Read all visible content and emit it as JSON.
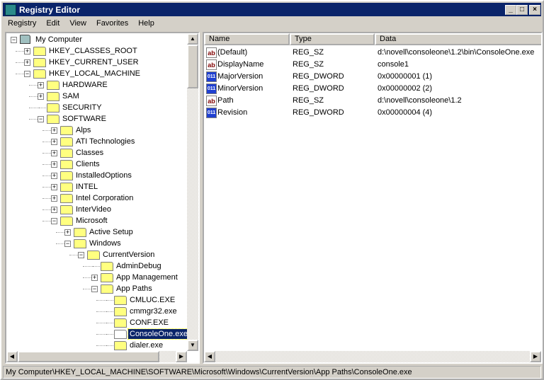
{
  "window": {
    "title": "Registry Editor"
  },
  "menu": [
    "Registry",
    "Edit",
    "View",
    "Favorites",
    "Help"
  ],
  "tree": [
    {
      "label": "My Computer",
      "level": 0,
      "exp": "-",
      "icon": "computer"
    },
    {
      "label": "HKEY_CLASSES_ROOT",
      "level": 1,
      "exp": "+"
    },
    {
      "label": "HKEY_CURRENT_USER",
      "level": 1,
      "exp": "+"
    },
    {
      "label": "HKEY_LOCAL_MACHINE",
      "level": 1,
      "exp": "-"
    },
    {
      "label": "HARDWARE",
      "level": 2,
      "exp": "+"
    },
    {
      "label": "SAM",
      "level": 2,
      "exp": "+"
    },
    {
      "label": "SECURITY",
      "level": 2,
      "exp": ""
    },
    {
      "label": "SOFTWARE",
      "level": 2,
      "exp": "-"
    },
    {
      "label": "Alps",
      "level": 3,
      "exp": "+"
    },
    {
      "label": "ATI Technologies",
      "level": 3,
      "exp": "+"
    },
    {
      "label": "Classes",
      "level": 3,
      "exp": "+"
    },
    {
      "label": "Clients",
      "level": 3,
      "exp": "+"
    },
    {
      "label": "InstalledOptions",
      "level": 3,
      "exp": "+"
    },
    {
      "label": "INTEL",
      "level": 3,
      "exp": "+"
    },
    {
      "label": "Intel Corporation",
      "level": 3,
      "exp": "+"
    },
    {
      "label": "InterVideo",
      "level": 3,
      "exp": "+"
    },
    {
      "label": "Microsoft",
      "level": 3,
      "exp": "-"
    },
    {
      "label": "Active Setup",
      "level": 4,
      "exp": "+"
    },
    {
      "label": "Windows",
      "level": 4,
      "exp": "-"
    },
    {
      "label": "CurrentVersion",
      "level": 5,
      "exp": "-"
    },
    {
      "label": "AdminDebug",
      "level": 6,
      "exp": ""
    },
    {
      "label": "App Management",
      "level": 6,
      "exp": "+"
    },
    {
      "label": "App Paths",
      "level": 6,
      "exp": "-"
    },
    {
      "label": "CMLUC.EXE",
      "level": 7,
      "exp": ""
    },
    {
      "label": "cmmgr32.exe",
      "level": 7,
      "exp": ""
    },
    {
      "label": "CONF.EXE",
      "level": 7,
      "exp": ""
    },
    {
      "label": "ConsoleOne.exe",
      "level": 7,
      "exp": "",
      "selected": true
    },
    {
      "label": "dialer.exe",
      "level": 7,
      "exp": ""
    }
  ],
  "columns": [
    "Name",
    "Type",
    "Data"
  ],
  "values": [
    {
      "name": "(Default)",
      "type": "REG_SZ",
      "data": "d:\\novell\\consoleone\\1.2\\bin\\ConsoleOne.exe",
      "icon": "sz"
    },
    {
      "name": "DisplayName",
      "type": "REG_SZ",
      "data": "console1",
      "icon": "sz"
    },
    {
      "name": "MajorVersion",
      "type": "REG_DWORD",
      "data": "0x00000001 (1)",
      "icon": "dw"
    },
    {
      "name": "MinorVersion",
      "type": "REG_DWORD",
      "data": "0x00000002 (2)",
      "icon": "dw"
    },
    {
      "name": "Path",
      "type": "REG_SZ",
      "data": "d:\\novell\\consoleone\\1.2",
      "icon": "sz"
    },
    {
      "name": "Revision",
      "type": "REG_DWORD",
      "data": "0x00000004 (4)",
      "icon": "dw"
    }
  ],
  "icons": {
    "sz": "ab",
    "dw": "011 110"
  },
  "status": "My Computer\\HKEY_LOCAL_MACHINE\\SOFTWARE\\Microsoft\\Windows\\CurrentVersion\\App Paths\\ConsoleOne.exe"
}
